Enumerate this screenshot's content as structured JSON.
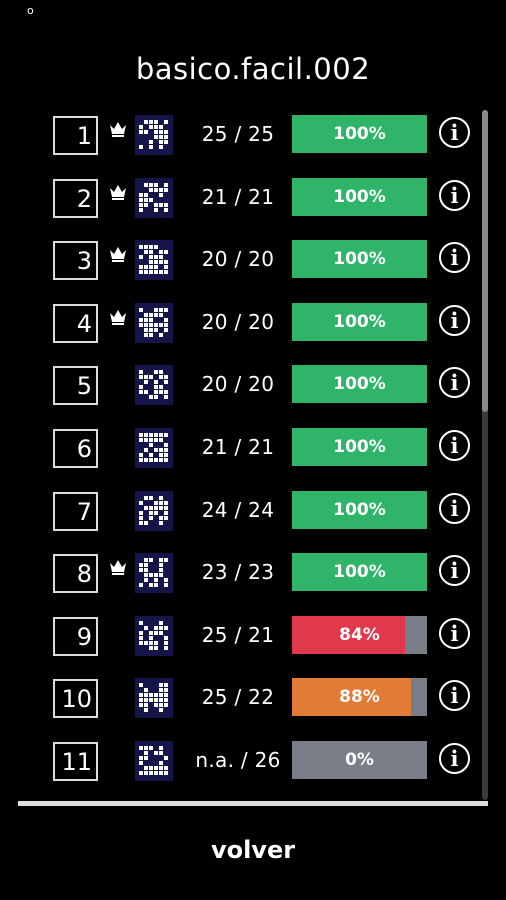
{
  "corner_mark": "o",
  "title": "basico.facil.002",
  "colors": {
    "complete": "#2fb46a",
    "low": "#e0384c",
    "medium": "#e27b35",
    "empty": "#7a7f87",
    "thumb_bg": "#15154a"
  },
  "rows": [
    {
      "num": "1",
      "crown": true,
      "icon": "puzzle-thumbnail-icon",
      "score": "25 / 25",
      "pct_label": "100%",
      "progress": 1.0,
      "status": "complete"
    },
    {
      "num": "2",
      "crown": true,
      "icon": "puzzle-thumbnail-icon",
      "score": "21 / 21",
      "pct_label": "100%",
      "progress": 1.0,
      "status": "complete"
    },
    {
      "num": "3",
      "crown": true,
      "icon": "puzzle-thumbnail-icon",
      "score": "20 / 20",
      "pct_label": "100%",
      "progress": 1.0,
      "status": "complete"
    },
    {
      "num": "4",
      "crown": true,
      "icon": "puzzle-thumbnail-icon",
      "score": "20 / 20",
      "pct_label": "100%",
      "progress": 1.0,
      "status": "complete"
    },
    {
      "num": "5",
      "crown": false,
      "icon": "puzzle-thumbnail-icon",
      "score": "20 / 20",
      "pct_label": "100%",
      "progress": 1.0,
      "status": "complete"
    },
    {
      "num": "6",
      "crown": false,
      "icon": "puzzle-thumbnail-icon",
      "score": "21 / 21",
      "pct_label": "100%",
      "progress": 1.0,
      "status": "complete"
    },
    {
      "num": "7",
      "crown": false,
      "icon": "puzzle-thumbnail-icon",
      "score": "24 / 24",
      "pct_label": "100%",
      "progress": 1.0,
      "status": "complete"
    },
    {
      "num": "8",
      "crown": true,
      "icon": "puzzle-thumbnail-icon",
      "score": "23 / 23",
      "pct_label": "100%",
      "progress": 1.0,
      "status": "complete"
    },
    {
      "num": "9",
      "crown": false,
      "icon": "puzzle-thumbnail-icon",
      "score": "25 / 21",
      "pct_label": "84%",
      "progress": 0.84,
      "status": "low"
    },
    {
      "num": "10",
      "crown": false,
      "icon": "puzzle-thumbnail-icon",
      "score": "25 / 22",
      "pct_label": "88%",
      "progress": 0.88,
      "status": "medium"
    },
    {
      "num": "11",
      "crown": false,
      "icon": "puzzle-thumbnail-icon",
      "score": "n.a. / 26",
      "pct_label": "0%",
      "progress": 0.0,
      "status": "empty"
    }
  ],
  "footer": {
    "back_label": "volver"
  }
}
